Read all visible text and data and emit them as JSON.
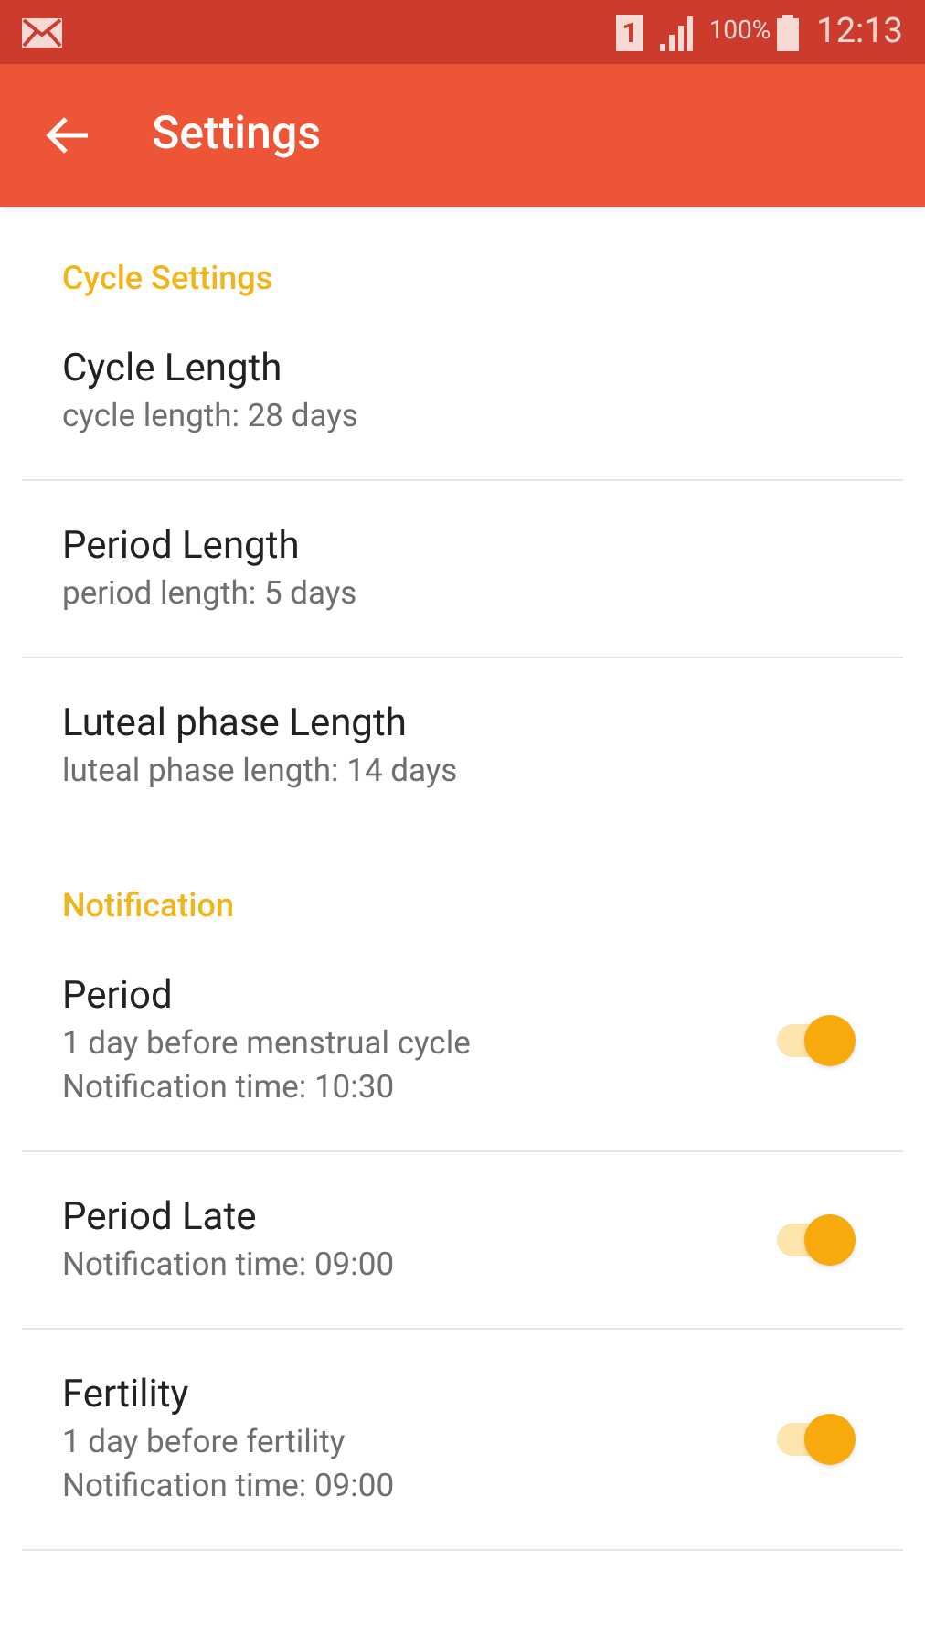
{
  "status_bar": {
    "sim": "1",
    "battery": "100%",
    "time": "12:13"
  },
  "app_bar": {
    "title": "Settings"
  },
  "sections": [
    {
      "title": "Cycle Settings",
      "items": [
        {
          "kind": "setting",
          "title": "Cycle Length",
          "lines": [
            "cycle length: 28 days"
          ]
        },
        {
          "kind": "setting",
          "title": "Period Length",
          "lines": [
            "period length: 5 days"
          ]
        },
        {
          "kind": "setting",
          "title": "Luteal phase Length",
          "lines": [
            "luteal phase length: 14 days"
          ]
        }
      ]
    },
    {
      "title": "Notification",
      "items": [
        {
          "kind": "toggle",
          "title": "Period",
          "lines": [
            "1 day before menstrual cycle",
            "Notification time: 10:30"
          ],
          "on": true
        },
        {
          "kind": "toggle",
          "title": "Period Late",
          "lines": [
            "Notification time: 09:00"
          ],
          "on": true
        },
        {
          "kind": "toggle",
          "title": "Fertility",
          "lines": [
            "1 day before fertility",
            "Notification time: 09:00"
          ],
          "on": true
        }
      ]
    }
  ]
}
